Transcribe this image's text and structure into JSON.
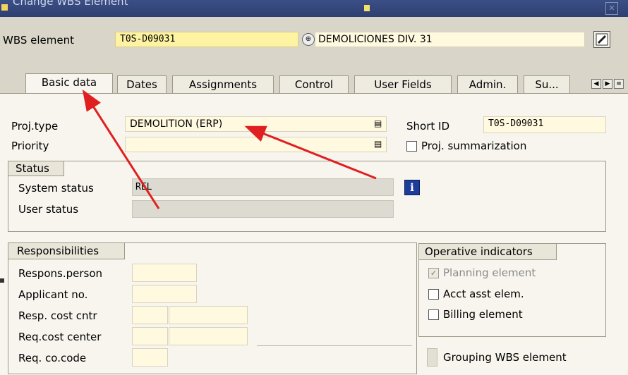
{
  "window": {
    "title": "Change WBS Element"
  },
  "header": {
    "wbs_label": "WBS element",
    "wbs_value": "T0S-D09031",
    "wbs_description": "DEMOLICIONES DIV. 31"
  },
  "tabs": [
    {
      "label": "Basic data"
    },
    {
      "label": "Dates"
    },
    {
      "label": "Assignments"
    },
    {
      "label": "Control"
    },
    {
      "label": "User Fields"
    },
    {
      "label": "Admin."
    },
    {
      "label": "Su..."
    }
  ],
  "basic": {
    "proj_type_label": "Proj.type",
    "proj_type_value": "DEMOLITION (ERP)",
    "priority_label": "Priority",
    "priority_value": "",
    "short_id_label": "Short ID",
    "short_id_value": "T0S-D09031",
    "proj_summarization_label": "Proj. summarization"
  },
  "status": {
    "title": "Status",
    "system_status_label": "System status",
    "system_status_value": "REL",
    "user_status_label": "User status",
    "user_status_value": ""
  },
  "responsibilities": {
    "title": "Responsibilities",
    "rows": [
      {
        "label": "Respons.person"
      },
      {
        "label": "Applicant no."
      },
      {
        "label": "Resp. cost cntr"
      },
      {
        "label": "Req.cost center"
      },
      {
        "label": "Req. co.code"
      }
    ]
  },
  "operative": {
    "title": "Operative indicators",
    "planning_element": "Planning element",
    "acct_asst_elem": "Acct asst elem.",
    "billing_element": "Billing element"
  },
  "grouping": {
    "label": "Grouping WBS element"
  },
  "colors": {
    "annotation_arrow": "#e02020",
    "title_bar": "#2e3f70",
    "key_field": "#fdf3a2"
  }
}
